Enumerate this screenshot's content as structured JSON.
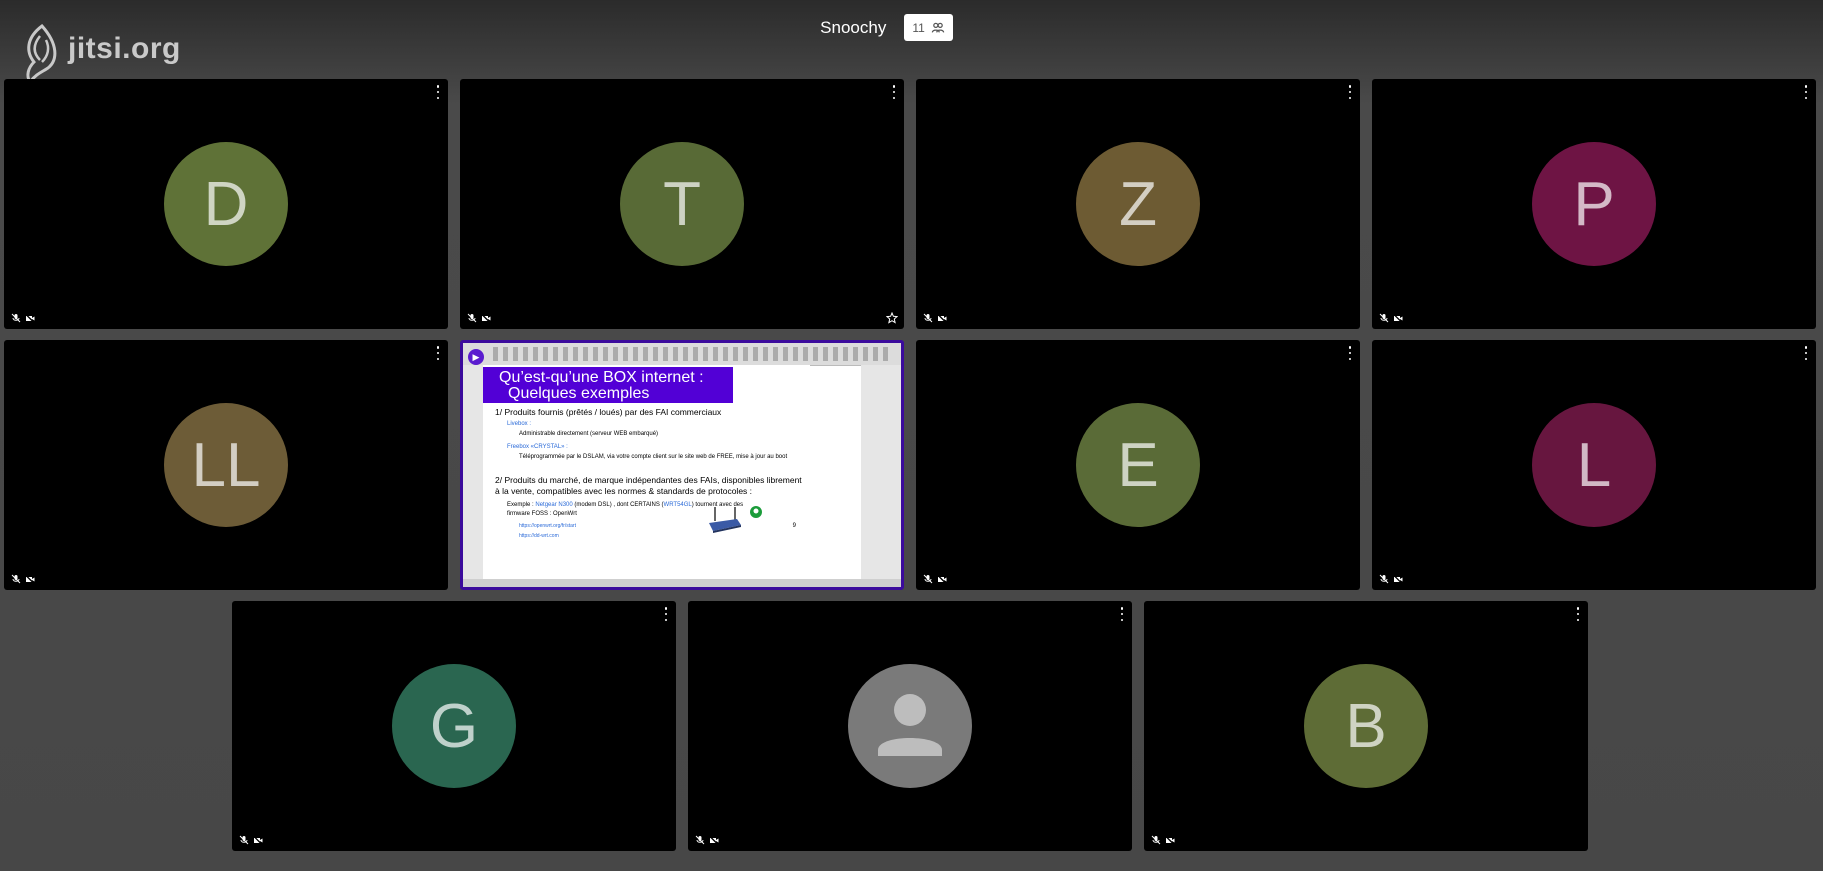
{
  "logo": {
    "text": "jitsi.org"
  },
  "header": {
    "subject": "Snoochy",
    "participant_count": "11",
    "participants_icon": "participants-icon"
  },
  "tiles": [
    {
      "initial": "D",
      "color": "#5f7237"
    },
    {
      "initial": "T",
      "color": "#586a36"
    },
    {
      "initial": "Z",
      "color": "#6d5b33"
    },
    {
      "initial": "P",
      "color": "#6e1444"
    },
    {
      "initial": "LL",
      "color": "#6d5c37"
    },
    {
      "initial": "E",
      "color": "#5a6b37"
    },
    {
      "initial": "L",
      "color": "#67163f"
    },
    {
      "initial": "G",
      "color": "#2a6650"
    },
    {
      "initial": "",
      "color": "#7a7a7a"
    },
    {
      "initial": "B",
      "color": "#5e6c36"
    }
  ],
  "screen_share": {
    "title_line1": "Qu’est-qu’une BOX internet :",
    "title_line2": "Quelques exemples",
    "section1": "1/ Produits fournis (prêtés / loués) par des FAI commerciaux",
    "livebox": "Livebox :",
    "livebox_detail": "Administrable directement (serveur WEB embarqué)",
    "freebox": "Freebox «CRYSTAL» :",
    "freebox_detail": "Téléprogrammée par le DSLAM, via votre compte client sur le site web de FREE, mise à jour au boot",
    "section2_line1": "2/ Produits du marché, de marque indépendantes des FAIs, disponibles librement",
    "section2_line2": "à la vente, compatibles avec les normes & standards de protocoles :",
    "example_prefix": "Exemple : ",
    "example_link1": "Netgear N300",
    "example_mid": " (modem DSL) , dont CERTAINS (",
    "example_link2": "WRT54GL",
    "example_suffix": ") tournent avec des",
    "example_line2": "firmware FOSS : OpenWrt",
    "link_openwrt": "https://openwrt.org/fr/start",
    "link_ddwrt": "https://dd-wrt.com",
    "page_number": "9"
  }
}
